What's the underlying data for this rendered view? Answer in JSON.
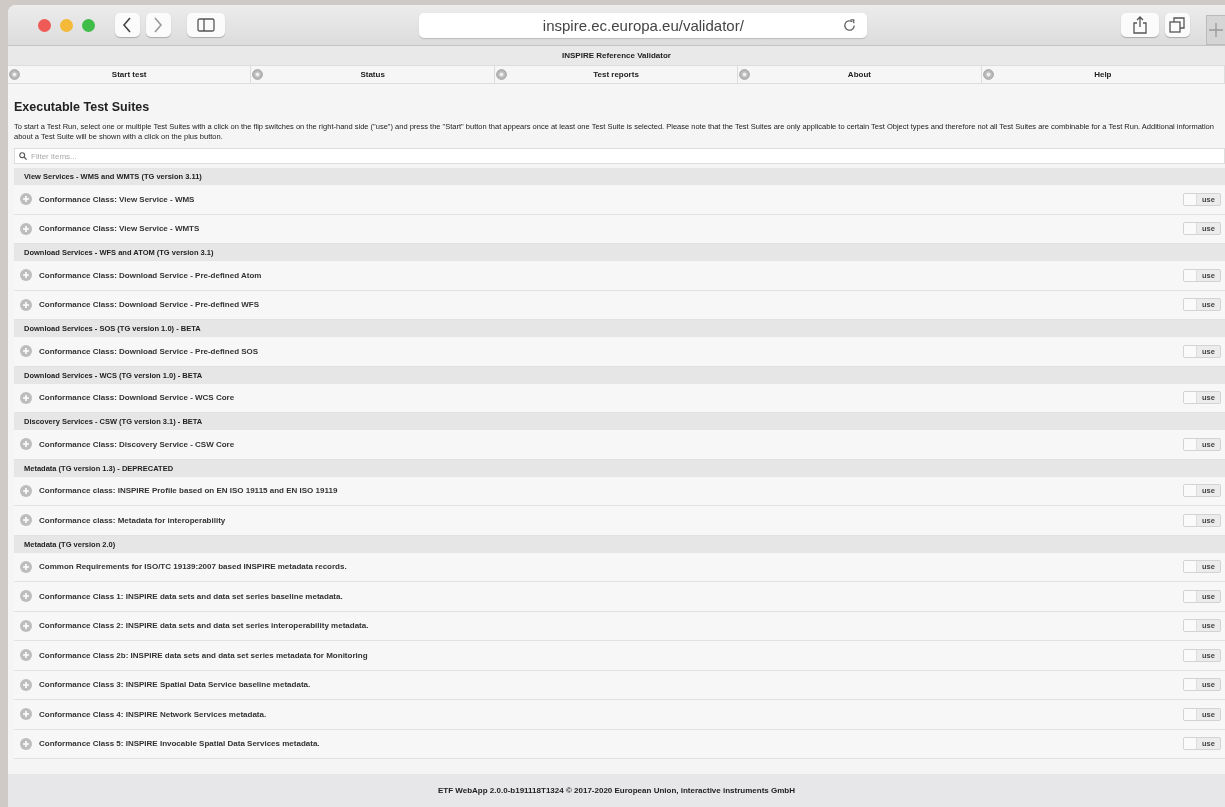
{
  "browser": {
    "url": "inspire.ec.europa.eu/validator/"
  },
  "app_title": "INSPIRE Reference Validator",
  "nav": [
    {
      "label": "Start test"
    },
    {
      "label": "Status"
    },
    {
      "label": "Test reports"
    },
    {
      "label": "About"
    },
    {
      "label": "Help"
    }
  ],
  "heading": "Executable Test Suites",
  "intro": "To start a Test Run, select one or multiple Test Suites with a click on the flip switches on the right-hand side (\"use\") and press the \"Start\" button that appears once at least one Test Suite is selected. Please note that the Test Suites are only applicable to certain Test Object types and therefore not all Test Suites are combinable for a Test Run. Additional information about a Test Suite will be shown with a click on the plus button.",
  "filter": {
    "placeholder": "Filter items..."
  },
  "groups": [
    {
      "title": "View Services - WMS and WMTS (TG version 3.11)",
      "items": [
        {
          "name": "Conformance Class: View Service - WMS",
          "switch_label": "use",
          "on": false
        },
        {
          "name": "Conformance Class: View Service - WMTS",
          "switch_label": "use",
          "on": false
        }
      ]
    },
    {
      "title": "Download Services - WFS and ATOM (TG version 3.1)",
      "items": [
        {
          "name": "Conformance Class: Download Service - Pre-defined Atom",
          "switch_label": "use",
          "on": false
        },
        {
          "name": "Conformance Class: Download Service - Pre-defined WFS",
          "switch_label": "use",
          "on": false
        }
      ]
    },
    {
      "title": "Download Services - SOS (TG version 1.0) - BETA",
      "items": [
        {
          "name": "Conformance Class: Download Service - Pre-defined SOS",
          "switch_label": "use",
          "on": false
        }
      ]
    },
    {
      "title": "Download Services - WCS (TG version 1.0) - BETA",
      "items": [
        {
          "name": "Conformance Class: Download Service - WCS Core",
          "switch_label": "use",
          "on": false
        }
      ]
    },
    {
      "title": "Discovery Services - CSW (TG version 3.1) - BETA",
      "items": [
        {
          "name": "Conformance Class: Discovery Service - CSW Core",
          "switch_label": "use",
          "on": false
        }
      ]
    },
    {
      "title": "Metadata (TG version 1.3) - DEPRECATED",
      "items": [
        {
          "name": "Conformance class: INSPIRE Profile based on EN ISO 19115 and EN ISO 19119",
          "switch_label": "use",
          "on": false
        },
        {
          "name": "Conformance class: Metadata for interoperability",
          "switch_label": "use",
          "on": false
        }
      ]
    },
    {
      "title": "Metadata (TG version 2.0)",
      "items": [
        {
          "name": "Common Requirements for ISO/TC 19139:2007 based INSPIRE metadata records.",
          "switch_label": "use",
          "on": false
        },
        {
          "name": "Conformance Class 1: INSPIRE data sets and data set series baseline metadata.",
          "switch_label": "use",
          "on": false
        },
        {
          "name": "Conformance Class 2: INSPIRE data sets and data set series interoperability metadata.",
          "switch_label": "use",
          "on": false
        },
        {
          "name": "Conformance Class 2b: INSPIRE data sets and data set series metadata for Monitoring",
          "switch_label": "use",
          "on": false
        },
        {
          "name": "Conformance Class 3: INSPIRE Spatial Data Service baseline metadata.",
          "switch_label": "use",
          "on": false
        },
        {
          "name": "Conformance Class 4: INSPIRE Network Services metadata.",
          "switch_label": "use",
          "on": false
        },
        {
          "name": "Conformance Class 5: INSPIRE Invocable Spatial Data Services metadata.",
          "switch_label": "use",
          "on": false
        }
      ]
    }
  ],
  "footer": "ETF WebApp 2.0.0-b191118T1324 © 2017-2020 European Union, interactive instruments GmbH"
}
